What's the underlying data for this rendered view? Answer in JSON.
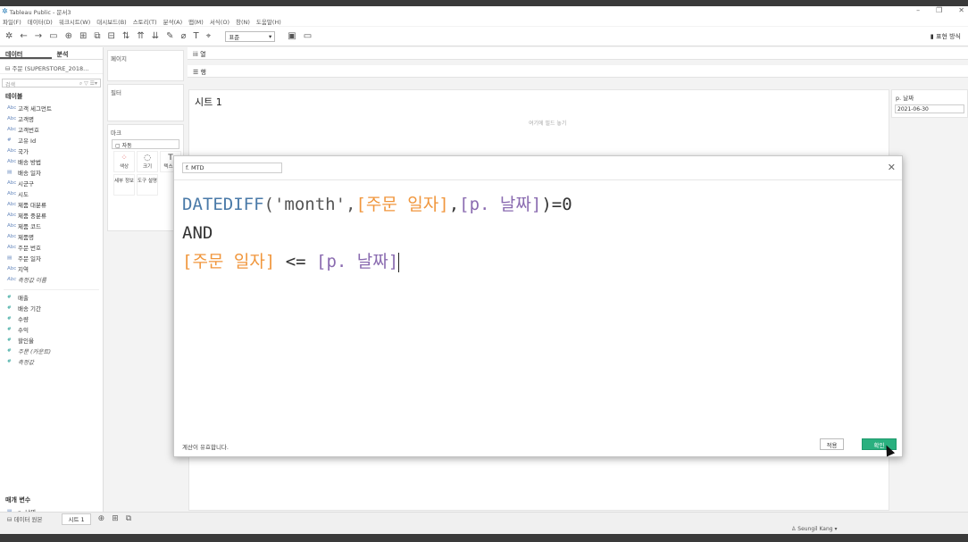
{
  "window": {
    "title": "Tableau Public - 문서3"
  },
  "menu": [
    "파일(F)",
    "데이터(D)",
    "워크시트(W)",
    "대시보드(B)",
    "스토리(T)",
    "분석(A)",
    "맵(M)",
    "서식(O)",
    "창(N)",
    "도움말(H)"
  ],
  "toolbar": {
    "fit_select": "표준",
    "show_me": "표현 방식"
  },
  "left": {
    "tab_data": "데이터",
    "tab_analysis": "분석",
    "datasource": "주문 (SUPERSTORE_2018...",
    "search_placeholder": "검색",
    "tables_label": "테이블",
    "dimensions": [
      {
        "type": "Abc",
        "name": "고객 세그먼트"
      },
      {
        "type": "Abc",
        "name": "고객명"
      },
      {
        "type": "Abc",
        "name": "고객번호"
      },
      {
        "type": "#",
        "name": "고유 Id"
      },
      {
        "type": "Abc",
        "name": "국가"
      },
      {
        "type": "Abc",
        "name": "배송 방법"
      },
      {
        "type": "▤",
        "name": "배송 일자"
      },
      {
        "type": "Abc",
        "name": "시군구"
      },
      {
        "type": "Abc",
        "name": "시도"
      },
      {
        "type": "Abc",
        "name": "제품 대분류"
      },
      {
        "type": "Abc",
        "name": "제품 중분류"
      },
      {
        "type": "Abc",
        "name": "제품 코드"
      },
      {
        "type": "Abc",
        "name": "제품명"
      },
      {
        "type": "Abc",
        "name": "주문 번호"
      },
      {
        "type": "▤",
        "name": "주문 일자"
      },
      {
        "type": "Abc",
        "name": "지역"
      },
      {
        "type": "Abc",
        "name": "측정값 이름"
      }
    ],
    "measures": [
      {
        "type": "#",
        "name": "매출"
      },
      {
        "type": "#",
        "name": "배송 기간"
      },
      {
        "type": "#",
        "name": "수량"
      },
      {
        "type": "#",
        "name": "수익"
      },
      {
        "type": "#",
        "name": "할인율"
      },
      {
        "type": "#",
        "name": "주문 (카운트)"
      },
      {
        "type": "#",
        "name": "측정값"
      }
    ],
    "params_label": "매개 변수",
    "param_item": "p. 날짜"
  },
  "shelves": {
    "pages": "페이지",
    "filters": "필터",
    "marks": "마크",
    "marks_type": "자동",
    "columns": "열",
    "rows": "행",
    "mark_buttons": [
      "색상",
      "크기",
      "텍스트",
      "세부 정보",
      "도구 설명"
    ]
  },
  "sheet": {
    "title": "시트 1",
    "drop_hint": "여기에 필드 놓기"
  },
  "param_card": {
    "label": "p. 날짜",
    "value": "2021-06-30"
  },
  "calc": {
    "name": "f. MTD",
    "line1": [
      "DATEDIFF",
      "('month',",
      "[주문 일자]",
      ",",
      "[p. 날짜]",
      ")=0"
    ],
    "line2": "AND",
    "line3": [
      "[주문 일자]",
      " <= ",
      "[p. 날짜]"
    ],
    "status": "계산이 유효합니다.",
    "apply": "적용",
    "ok": "확인"
  },
  "bottom": {
    "datasource_tab": "데이터 원본",
    "sheet_tab": "시트 1",
    "user": "Seungil Kang"
  }
}
